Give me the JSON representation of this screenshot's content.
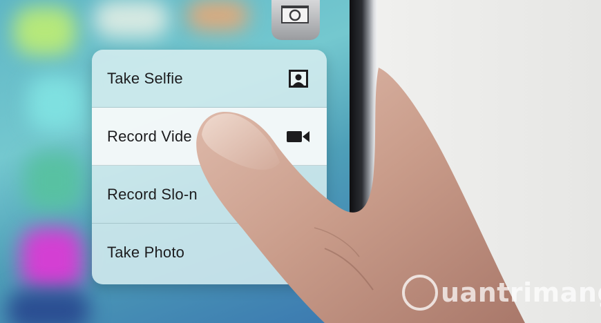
{
  "quick_actions": {
    "items": [
      {
        "label": "Take Selfie",
        "icon": "front-camera-portrait-icon"
      },
      {
        "label": "Record Vide",
        "icon": "video-camera-icon"
      },
      {
        "label": "Record Slo-n",
        "icon": ""
      },
      {
        "label": "Take Photo",
        "icon": ""
      }
    ]
  },
  "app_icon": {
    "name": "camera-app-icon"
  },
  "watermark": {
    "text": "uantrimang"
  },
  "colors": {
    "menu_background": "#d7eef0",
    "highlight": "#f4f9f9",
    "text": "#1c1c1e"
  }
}
